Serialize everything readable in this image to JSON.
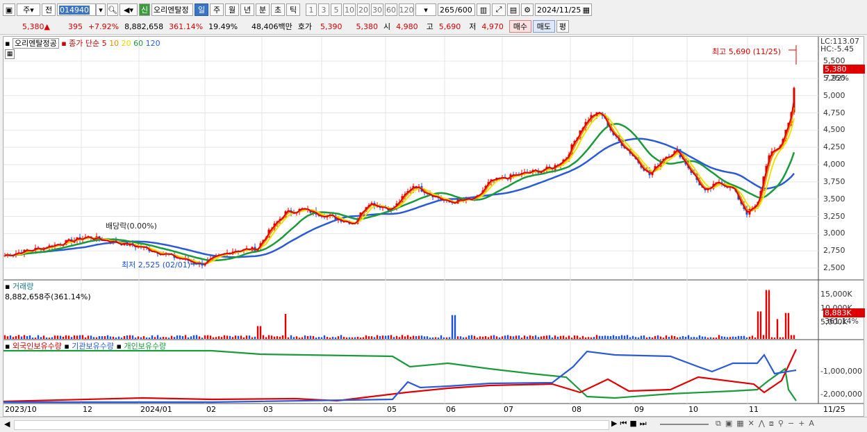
{
  "toolbar": {
    "type_select": "주",
    "prefix": "전",
    "code": "014940",
    "credit_badge": "신",
    "stock_name": "오리엔탈정",
    "periods": [
      "일",
      "주",
      "월",
      "년",
      "분",
      "초",
      "틱"
    ],
    "active_period": "일",
    "intervals": [
      "1",
      "3",
      "5",
      "10",
      "20",
      "30",
      "60",
      "120"
    ],
    "count": "265",
    "count_max": "/600",
    "date": "2024/11/25"
  },
  "quote": {
    "price": "5,380",
    "arrow": "▲",
    "change": "395",
    "rate": "+7.92%",
    "volume": "8,882,658",
    "vol_ratio": "361.14%",
    "turnover": "19.49%",
    "amount": "48,406백만",
    "hoga_label": "호가",
    "ask": "5,390",
    "bid": "5,380",
    "open_label": "시",
    "open": "4,980",
    "high_label": "고",
    "high": "5,690",
    "low_label": "저",
    "low": "4,970",
    "buy_btn": "매수",
    "sell_btn": "매도",
    "eval_btn": "평"
  },
  "price_panel": {
    "legend_name": "오리엔탈정공",
    "legend_ma": "종가 단순",
    "ma_periods": [
      "5",
      "10",
      "20",
      "60",
      "120"
    ],
    "lc": "LC:113.07",
    "hc": "HC:-5.45",
    "last_price": "5,380",
    "last_rate": "7.92%",
    "y_ticks": [
      "5,500",
      "5,250",
      "5,000",
      "4,750",
      "4,500",
      "4,250",
      "4,000",
      "3,750",
      "3,500",
      "3,250",
      "3,000",
      "2,750",
      "2,500"
    ],
    "high_note": "최고 5,690 (11/25)",
    "low_note": "최저 2,525 (02/01)",
    "dividend_note": "배당락(0.00%)"
  },
  "volume_panel": {
    "title": "거래량",
    "value": "8,882,658주(361.14%)",
    "y_ticks": [
      "15,000K",
      "10,000K",
      "5,000K"
    ],
    "last_value": "8,883K",
    "last_rate": "361.14%"
  },
  "holding_panel": {
    "series": [
      "외국인보유수량",
      "기관보유수량",
      "개인보유수량"
    ],
    "y_ticks": [
      "-1,000,000",
      "-2,000,000"
    ]
  },
  "x_axis": [
    "2023/10",
    "12",
    "2024/01",
    "02",
    "03",
    "04",
    "05",
    "06",
    "07",
    "08",
    "09",
    "10",
    "11",
    "11/25"
  ],
  "colors": {
    "up": "#e00000",
    "down": "#1a4fd8",
    "ma5": "#e00000",
    "ma10": "#f08c00",
    "ma20": "#f0e000",
    "ma60": "#1a9a3a",
    "ma120": "#2a5ad8"
  }
}
